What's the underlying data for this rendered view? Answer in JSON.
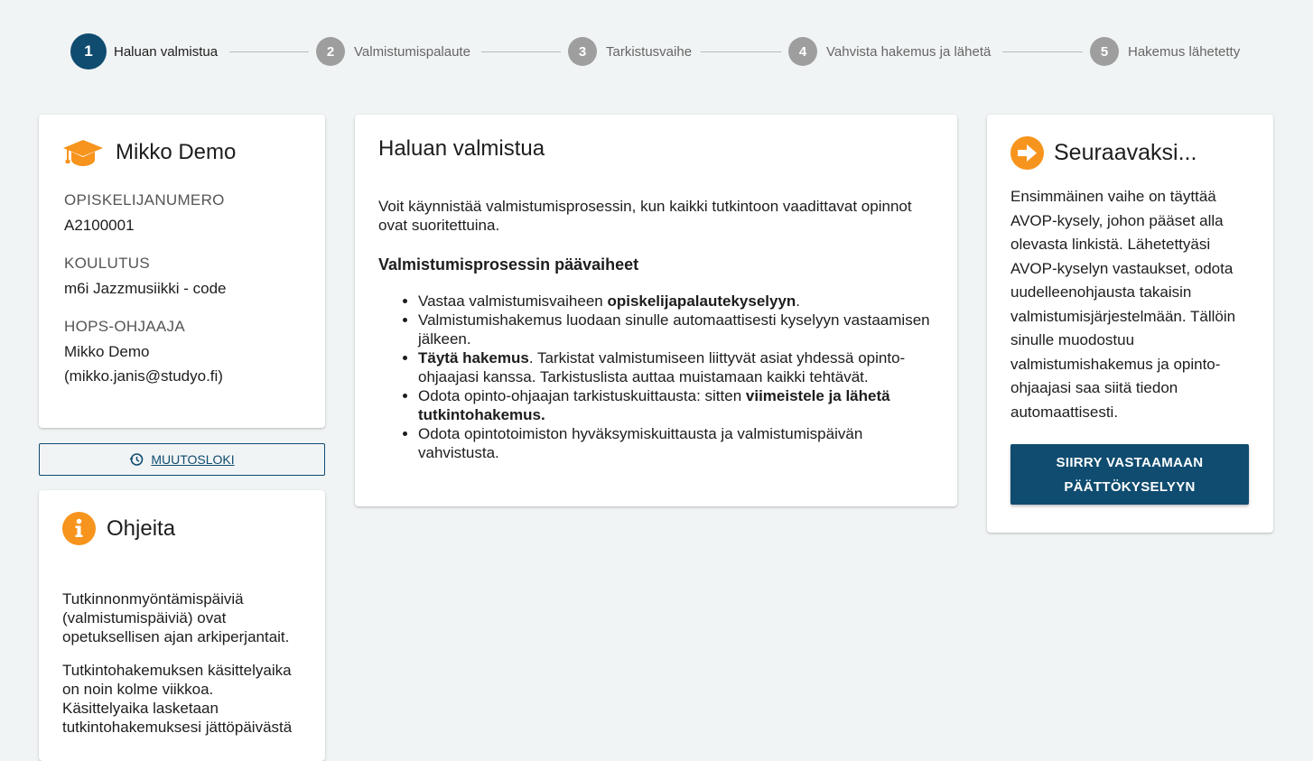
{
  "stepper": {
    "steps": [
      {
        "number": "1",
        "label": "Haluan valmistua",
        "active": true
      },
      {
        "number": "2",
        "label": "Valmistumispalaute",
        "active": false
      },
      {
        "number": "3",
        "label": "Tarkistusvaihe",
        "active": false
      },
      {
        "number": "4",
        "label": "Vahvista hakemus ja lähetä",
        "active": false
      },
      {
        "number": "5",
        "label": "Hakemus lähetetty",
        "active": false
      }
    ]
  },
  "profile": {
    "name": "Mikko Demo",
    "student_number_label": "OPISKELIJANUMERO",
    "student_number": "A2100001",
    "program_label": "KOULUTUS",
    "program": "m6i Jazzmusiikki - code",
    "advisor_label": "HOPS-OHJAAJA",
    "advisor_name": "Mikko Demo",
    "advisor_email": "(mikko.janis@studyo.fi)"
  },
  "changelog": {
    "label": "MUUTOSLOKI"
  },
  "help": {
    "title": "Ohjeita",
    "p1": "Tutkinnonmyöntämispäiviä (valmistumispäiviä) ovat opetuksellisen ajan arkiperjantait.",
    "p2": "Tutkintohakemuksen käsittelyaika on noin kolme viikkoa. Käsittelyaika lasketaan tutkintohakemuksesi jättöpäivästä"
  },
  "main": {
    "title": "Haluan valmistua",
    "intro": "Voit käynnistää valmistumisprosessin, kun kaikki tutkintoon vaadittavat opinnot ovat suoritettuina.",
    "subtitle": "Valmistumisprosessin päävaiheet",
    "li1_a": "Vastaa valmistumisvaiheen ",
    "li1_b": "opiskelijapalautekyselyyn",
    "li1_c": ".",
    "li2": "Valmistumishakemus luodaan sinulle automaattisesti kyselyyn vastaamisen jälkeen.",
    "li3_a": "Täytä hakemus",
    "li3_b": ". Tarkistat valmistumiseen liittyvät asiat yhdessä opinto-ohjaajasi kanssa. Tarkistuslista auttaa muistamaan kaikki tehtävät.",
    "li4_a": "Odota opinto-ohjaajan tarkistuskuittausta: sitten ",
    "li4_b": "viimeistele ja lähetä tutkintohakemus.",
    "li5": "Odota opintotoimiston hyväksymiskuittausta ja valmistumispäivän vahvistusta."
  },
  "next": {
    "title": "Seuraavaksi...",
    "text": "Ensimmäinen vaihe on täyttää AVOP-kysely, johon pääset alla olevasta linkistä. Lähetettyäsi AVOP-kyselyn vastaukset, odota uudelleenohjausta takaisin valmistumisjärjestelmään. Tällöin sinulle muodostuu valmistumishakemus ja opinto-ohjaajasi saa siitä tiedon automaattisesti.",
    "button_label": "SIIRRY VASTAAMAAN PÄÄTTÖKYSELYYN"
  },
  "colors": {
    "primary": "#0f4c70",
    "accent": "#f7941d",
    "inactive_step": "#9e9e9e",
    "background": "#f1f4f5"
  },
  "icons": {
    "profile": "graduation-cap-icon",
    "changelog": "history-icon",
    "help": "info-icon",
    "next": "arrow-right-circle-icon"
  }
}
